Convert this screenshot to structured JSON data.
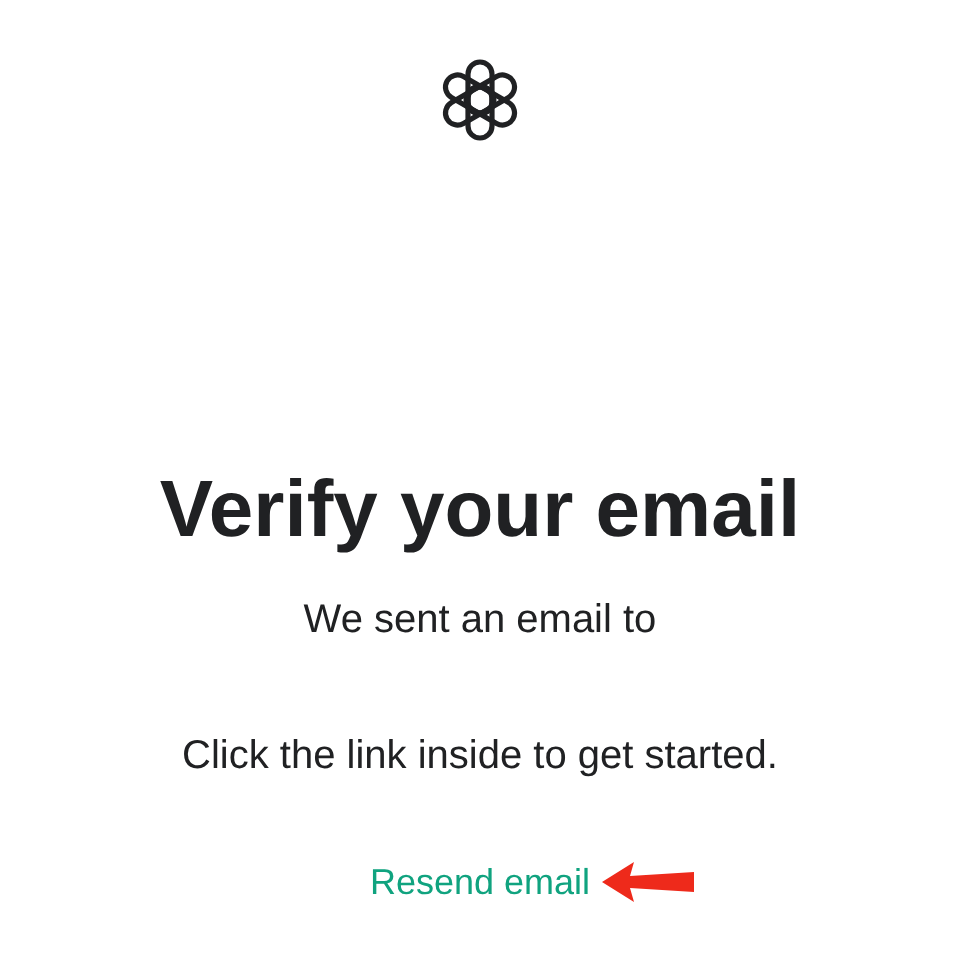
{
  "heading": "Verify your email",
  "message": "We sent an email to",
  "instruction": "Click the link inside to get started.",
  "resend_link": "Resend email"
}
